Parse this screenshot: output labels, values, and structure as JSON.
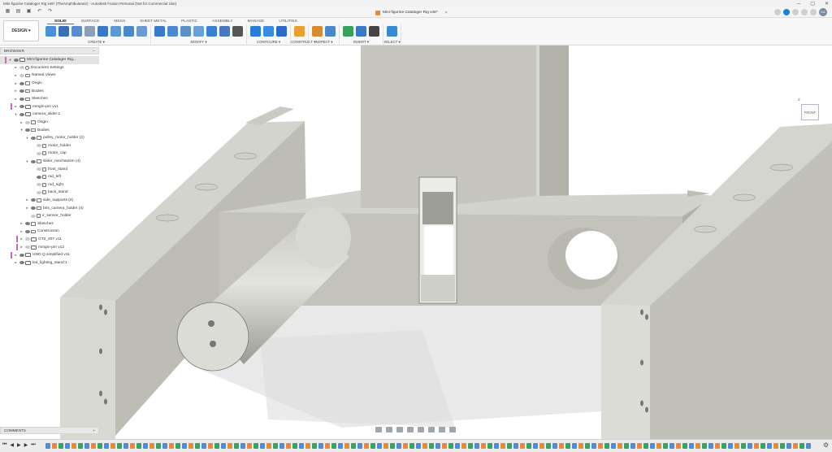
{
  "window": {
    "title": "Mini-figurine Cataloger Rig v46* (TheAmphibuleator) - Autodesk Fusion Personal (Not for Commercial Use)",
    "controls": [
      "─",
      "▢",
      "✕"
    ]
  },
  "document_tab": {
    "label": "Mini-figurine Cataloger Rig v46*",
    "close": "×"
  },
  "user_initials": "KA",
  "workspace_button": "DESIGN ▾",
  "tabs": [
    "SOLID",
    "SURFACE",
    "MESH",
    "SHEET METAL",
    "PLASTIC",
    "ASSEMBLY",
    "MANAGE",
    "UTILITIES"
  ],
  "active_tab": "SOLID",
  "tool_groups": [
    {
      "label": "CREATE ▾",
      "icons": [
        "sketch-icon",
        "extrude-icon",
        "revolve-icon",
        "hole-icon",
        "box-icon",
        "sweep-icon",
        "pattern-icon",
        "mirror-icon"
      ],
      "colors": [
        "#4a8fd8",
        "#3a6fb8",
        "#5a8ad0",
        "#8aa0b8",
        "#3a78c8",
        "#5a9ad0",
        "#4a88c8",
        "#6a9ad0"
      ]
    },
    {
      "label": "MODIFY ▾",
      "icons": [
        "press-pull-icon",
        "fillet-icon",
        "chamfer-icon",
        "shell-icon",
        "combine-icon",
        "align-icon",
        "move-icon"
      ],
      "colors": [
        "#3a78c8",
        "#4a88d0",
        "#5a90c8",
        "#6aa0d8",
        "#3a80d0",
        "#4a78c0",
        "#555555"
      ]
    },
    {
      "label": "CONFIGURE ▾",
      "icons": [
        "configure-table-icon",
        "configure-rule-icon",
        "configure-theme-icon"
      ],
      "colors": [
        "#2a7ad8",
        "#3a8ae0",
        "#2a6ac8"
      ]
    },
    {
      "label": "CONSTRUCT ▾",
      "icons": [
        "offset-plane-icon"
      ],
      "colors": [
        "#e8a030"
      ]
    },
    {
      "label": "INSPECT ▾",
      "icons": [
        "measure-icon",
        "interference-icon"
      ],
      "colors": [
        "#d88a30",
        "#4a88c8"
      ]
    },
    {
      "label": "INSERT ▾",
      "icons": [
        "insert-derive-icon",
        "insert-canvas-icon",
        "insert-mcmaster-icon"
      ],
      "colors": [
        "#3aa060",
        "#3a78c8",
        "#444444"
      ]
    },
    {
      "label": "SELECT ▾",
      "icons": [
        "select-window-icon"
      ],
      "colors": [
        "#3a88d0"
      ]
    }
  ],
  "browser": {
    "header": "BROWSER",
    "items": [
      {
        "label": "Mini-figurine Cataloger Rig...",
        "depth": 0,
        "arrow": "▾",
        "icon": "comp",
        "eye": true,
        "root": true,
        "tag": "#c86ab8"
      },
      {
        "label": "Document Settings",
        "depth": 1,
        "arrow": "▸",
        "icon": "gear",
        "eye": false
      },
      {
        "label": "Named Views",
        "depth": 1,
        "arrow": "▸",
        "icon": "folder",
        "eye": false
      },
      {
        "label": "Origin",
        "depth": 1,
        "arrow": "▸",
        "icon": "folder",
        "eye": true
      },
      {
        "label": "Bodies",
        "depth": 1,
        "arrow": "▸",
        "icon": "folder",
        "eye": true
      },
      {
        "label": "Sketches",
        "depth": 1,
        "arrow": "▸",
        "icon": "folder",
        "eye": true
      },
      {
        "label": "mmgm-pm v11",
        "depth": 1,
        "arrow": "▸",
        "icon": "comp",
        "eye": true,
        "tag": "#c86ab8"
      },
      {
        "label": "camera_slider:1",
        "depth": 1,
        "arrow": "▾",
        "icon": "comp",
        "eye": true
      },
      {
        "label": "Origin",
        "depth": 2,
        "arrow": "▸",
        "icon": "folder",
        "eye": false
      },
      {
        "label": "Bodies",
        "depth": 2,
        "arrow": "▾",
        "icon": "folder",
        "eye": true
      },
      {
        "label": "pulley_motor_holder (2)",
        "depth": 3,
        "arrow": "▾",
        "icon": "folder",
        "eye": true
      },
      {
        "label": "motor_holder",
        "depth": 4,
        "arrow": "",
        "icon": "body",
        "eye": false
      },
      {
        "label": "motor_cap",
        "depth": 4,
        "arrow": "",
        "icon": "body",
        "eye": false
      },
      {
        "label": "slider_mechanism (4)",
        "depth": 3,
        "arrow": "▾",
        "icon": "folder",
        "eye": true
      },
      {
        "label": "front_stand",
        "depth": 4,
        "arrow": "",
        "icon": "body",
        "eye": false
      },
      {
        "label": "rod_left",
        "depth": 4,
        "arrow": "",
        "icon": "body",
        "eye": true
      },
      {
        "label": "rod_right",
        "depth": 4,
        "arrow": "",
        "icon": "body",
        "eye": false
      },
      {
        "label": "back_stand",
        "depth": 4,
        "arrow": "",
        "icon": "body",
        "eye": false
      },
      {
        "label": "side_supports (2)",
        "depth": 3,
        "arrow": "▸",
        "icon": "folder",
        "eye": true
      },
      {
        "label": "bris_camera_holder (4)",
        "depth": 3,
        "arrow": "▸",
        "icon": "folder",
        "eye": true
      },
      {
        "label": "ir_sensor_holder",
        "depth": 3,
        "arrow": "",
        "icon": "body",
        "eye": false
      },
      {
        "label": "Sketches",
        "depth": 2,
        "arrow": "▸",
        "icon": "folder",
        "eye": true
      },
      {
        "label": "Construction",
        "depth": 2,
        "arrow": "▸",
        "icon": "folder",
        "eye": true
      },
      {
        "label": "GT2_20T v11",
        "depth": 2,
        "arrow": "▸",
        "icon": "comp",
        "eye": false,
        "tag": "#c86ab8"
      },
      {
        "label": "mmgm-pm v12",
        "depth": 2,
        "arrow": "▸",
        "icon": "comp",
        "eye": false,
        "tag": "#c86ab8"
      },
      {
        "label": "UNO Q simplified v11",
        "depth": 1,
        "arrow": "▸",
        "icon": "comp",
        "eye": true,
        "tag": "#c86ab8"
      },
      {
        "label": "led_lighting_stand:1",
        "depth": 1,
        "arrow": "▸",
        "icon": "comp",
        "eye": true
      }
    ]
  },
  "viewcube": {
    "face": "FRONT",
    "axis": "Z"
  },
  "comments": {
    "label": "COMMENTS",
    "add": "+"
  },
  "timeline_controls": [
    "⏮",
    "◀",
    "▶",
    "▶",
    "⏭"
  ],
  "timeline_feature_count": 118
}
